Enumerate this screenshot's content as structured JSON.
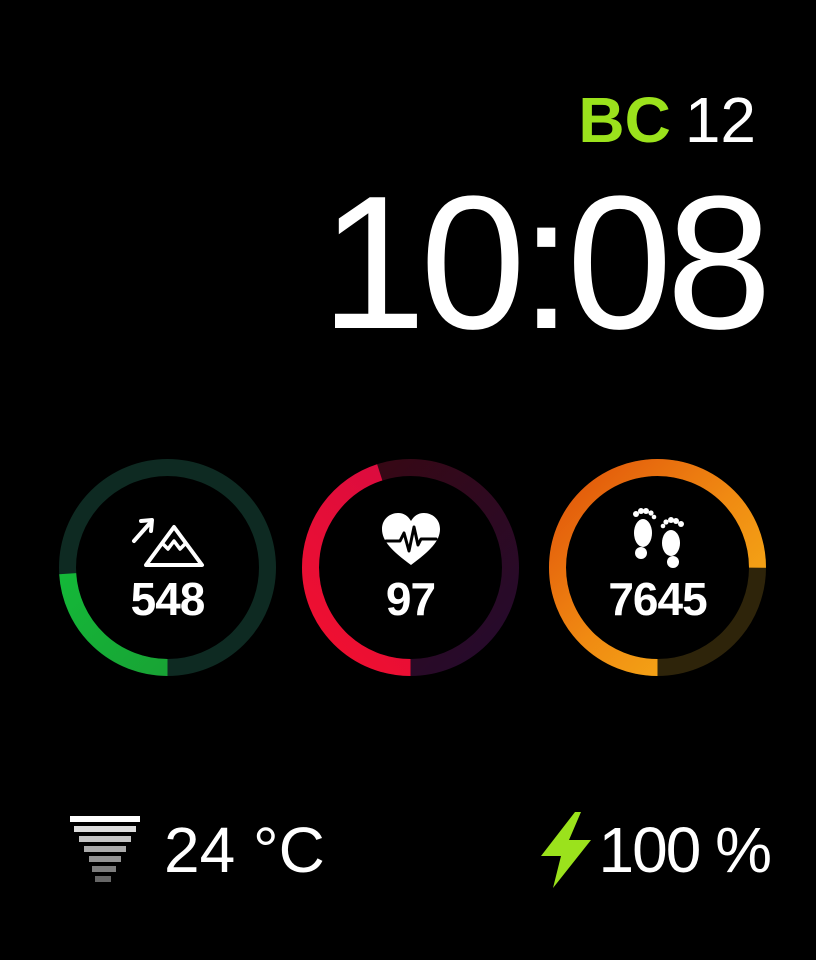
{
  "header": {
    "era": "BC",
    "day": "12",
    "time": "10:08",
    "era_color": "#9be21c"
  },
  "metrics": [
    {
      "name": "elevation",
      "icon": "mountain-icon",
      "value": "548",
      "progress": 0.24,
      "color": "#1fb03a",
      "track_color": "#0e2a22"
    },
    {
      "name": "heart-rate",
      "icon": "heart-pulse-icon",
      "value": "97",
      "progress": 0.45,
      "color": "#e3103c",
      "track_color": "#3a0812"
    },
    {
      "name": "steps",
      "icon": "footprints-icon",
      "value": "7645",
      "progress": 0.75,
      "color": "#f2a413",
      "track_color": "#2e240a"
    }
  ],
  "weather": {
    "icon": "tornado-icon",
    "temperature": "24 °C"
  },
  "battery": {
    "icon": "lightning-bolt-icon",
    "level": "100 %",
    "color": "#9be21c"
  }
}
